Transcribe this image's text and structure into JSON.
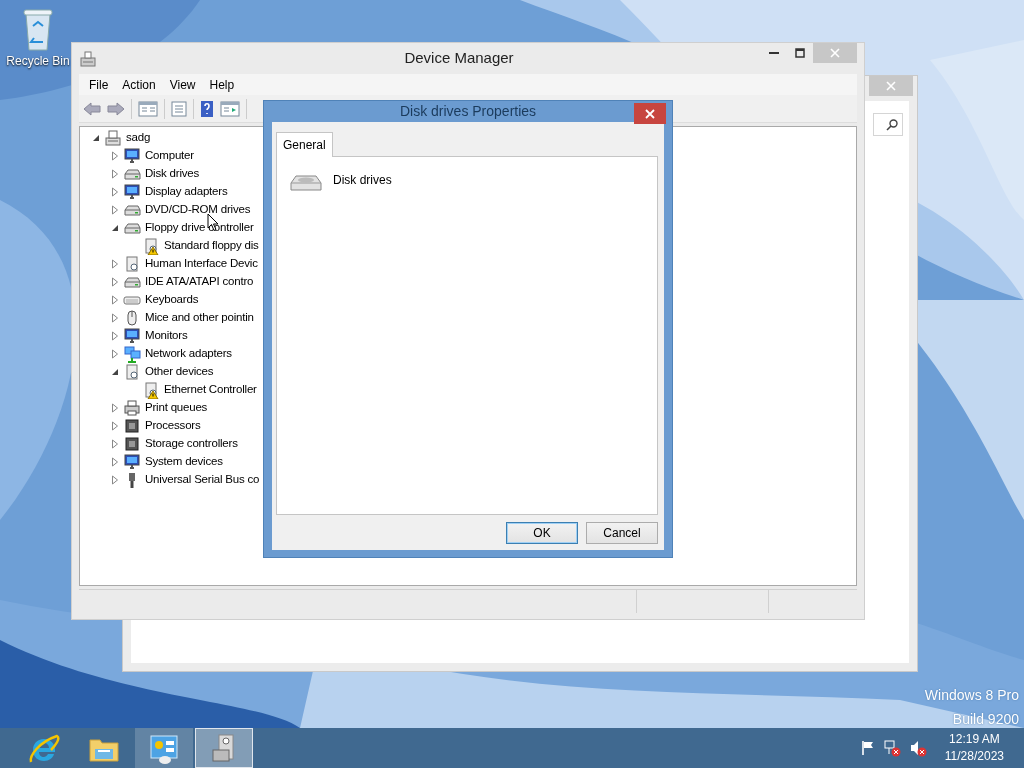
{
  "desktop": {
    "icons": [
      {
        "label": "Recycle Bin"
      }
    ],
    "edition": "Windows 8 Pro",
    "build": "Build 9200"
  },
  "device_manager": {
    "title": "Device Manager",
    "menu": [
      "File",
      "Action",
      "View",
      "Help"
    ],
    "tree": {
      "label": "sadg",
      "expanded": true,
      "children": [
        {
          "label": "Computer",
          "expanded": false
        },
        {
          "label": "Disk drives",
          "expanded": false
        },
        {
          "label": "Display adapters",
          "expanded": false
        },
        {
          "label": "DVD/CD-ROM drives",
          "expanded": false
        },
        {
          "label": "Floppy drive controller",
          "expanded": true,
          "children": [
            {
              "label": "Standard floppy dis",
              "warning": true
            }
          ]
        },
        {
          "label": "Human Interface Devic",
          "expanded": false
        },
        {
          "label": "IDE ATA/ATAPI contro",
          "expanded": false
        },
        {
          "label": "Keyboards",
          "expanded": false
        },
        {
          "label": "Mice and other pointin",
          "expanded": false
        },
        {
          "label": "Monitors",
          "expanded": false
        },
        {
          "label": "Network adapters",
          "expanded": false
        },
        {
          "label": "Other devices",
          "expanded": true,
          "children": [
            {
              "label": "Ethernet Controller",
              "warning": true
            }
          ]
        },
        {
          "label": "Print queues",
          "expanded": false
        },
        {
          "label": "Processors",
          "expanded": false
        },
        {
          "label": "Storage controllers",
          "expanded": false
        },
        {
          "label": "System devices",
          "expanded": false
        },
        {
          "label": "Universal Serial Bus co",
          "expanded": false
        }
      ]
    }
  },
  "dialog": {
    "title": "Disk drives Properties",
    "tabs": [
      {
        "label": "General",
        "selected": true
      }
    ],
    "device_name": "Disk drives",
    "buttons": [
      {
        "label": "OK",
        "default": true
      },
      {
        "label": "Cancel",
        "default": false
      }
    ]
  },
  "taskbar": {
    "apps": [
      {
        "selected": false,
        "running": false
      },
      {
        "selected": false,
        "running": false
      },
      {
        "selected": false,
        "running": true
      },
      {
        "selected": true,
        "running": true
      }
    ],
    "clock": {
      "time": "12:19 AM",
      "date": "11/28/2023"
    }
  }
}
